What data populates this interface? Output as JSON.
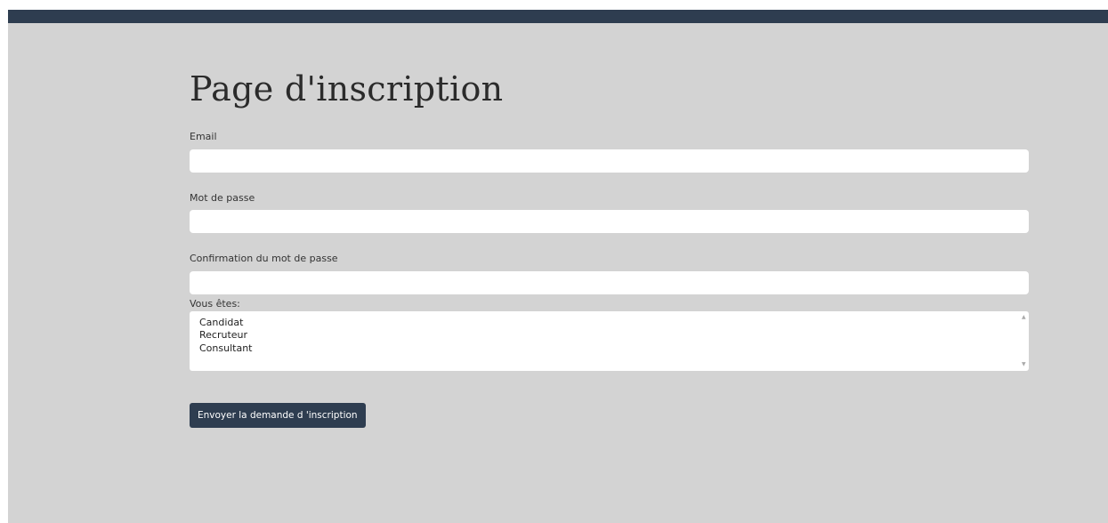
{
  "page": {
    "title": "Page d'inscription"
  },
  "form": {
    "email_label": "Email",
    "email_value": "",
    "password_label": "Mot de passe",
    "password_value": "",
    "confirm_label": "Confirmation du mot de passe",
    "confirm_value": "",
    "role_label": "Vous êtes:",
    "role_options": [
      "Candidat",
      "Recruteur",
      "Consultant"
    ],
    "submit_label": "Envoyer la demande d 'inscription"
  },
  "colors": {
    "topbar": "#2e3d50",
    "background": "#d3d3d3",
    "button": "#2e3d50"
  },
  "icons": {
    "scroll_up": "scroll-up-arrow-icon",
    "scroll_down": "scroll-down-arrow-icon"
  }
}
